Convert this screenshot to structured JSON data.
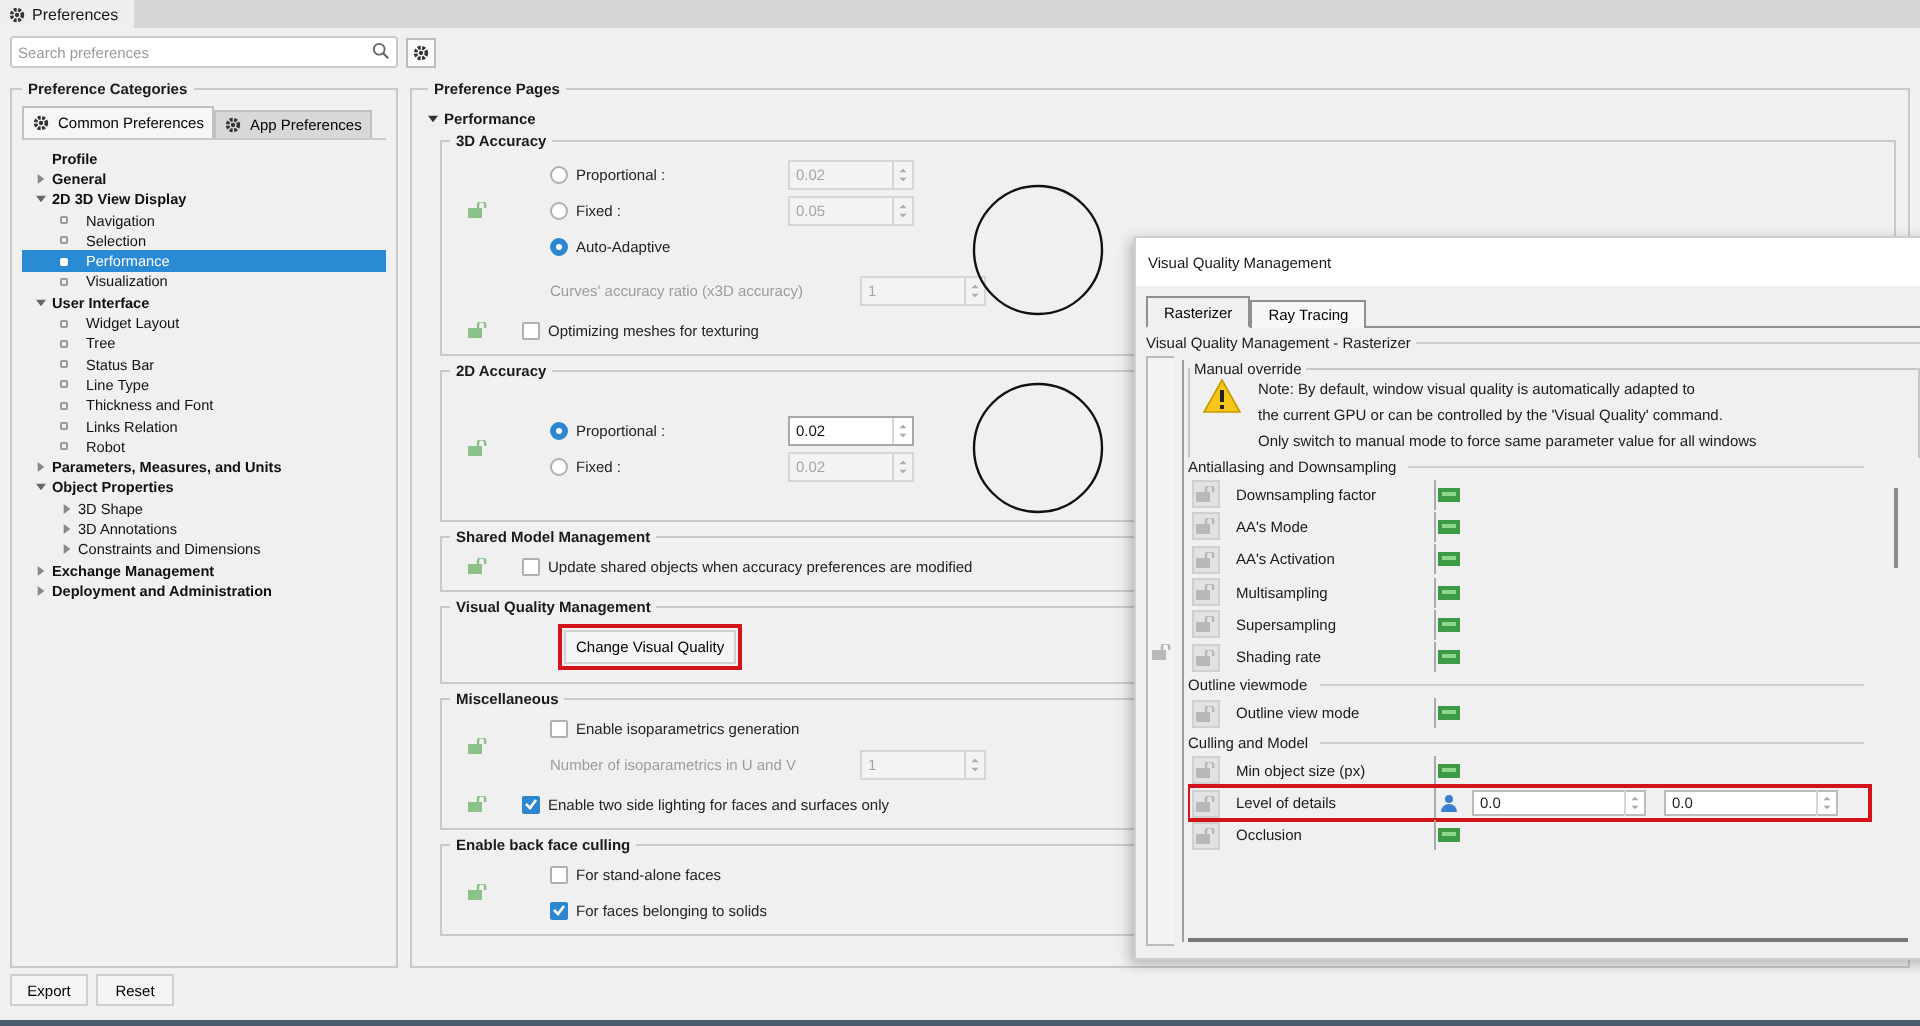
{
  "window": {
    "title": "Preferences"
  },
  "search": {
    "placeholder": "Search preferences"
  },
  "categories": {
    "title": "Preference Categories",
    "tabs": [
      {
        "label": "Common Preferences",
        "selected": true
      },
      {
        "label": "App Preferences",
        "selected": false
      }
    ],
    "tree": [
      {
        "label": "Profile",
        "kind": "plain",
        "selected": false
      },
      {
        "label": "General",
        "kind": "branch",
        "expanded": false,
        "selected": false
      },
      {
        "label": "2D 3D View Display",
        "kind": "branch",
        "expanded": true,
        "selected": false,
        "children": [
          {
            "label": "Navigation",
            "kind": "leaf",
            "selected": false
          },
          {
            "label": "Selection",
            "kind": "leaf",
            "selected": false
          },
          {
            "label": "Performance",
            "kind": "leaf",
            "selected": true
          },
          {
            "label": "Visualization",
            "kind": "leaf",
            "selected": false
          }
        ]
      },
      {
        "label": "User Interface",
        "kind": "branch",
        "expanded": true,
        "selected": false,
        "children": [
          {
            "label": "Widget Layout",
            "kind": "leaf",
            "selected": false
          },
          {
            "label": "Tree",
            "kind": "leaf",
            "selected": false
          },
          {
            "label": "Status Bar",
            "kind": "leaf",
            "selected": false
          },
          {
            "label": "Line Type",
            "kind": "leaf",
            "selected": false
          },
          {
            "label": "Thickness and Font",
            "kind": "leaf",
            "selected": false
          },
          {
            "label": "Links Relation",
            "kind": "leaf",
            "selected": false
          },
          {
            "label": "Robot",
            "kind": "leaf",
            "selected": false
          }
        ]
      },
      {
        "label": "Parameters, Measures, and Units",
        "kind": "branch",
        "expanded": false,
        "selected": false
      },
      {
        "label": "Object Properties",
        "kind": "branch",
        "expanded": true,
        "selected": false,
        "children": [
          {
            "label": "3D Shape",
            "kind": "branch",
            "expanded": false,
            "selected": false
          },
          {
            "label": "3D Annotations",
            "kind": "branch",
            "expanded": false,
            "selected": false
          },
          {
            "label": "Constraints and Dimensions",
            "kind": "branch",
            "expanded": false,
            "selected": false
          }
        ]
      },
      {
        "label": "Exchange Management",
        "kind": "branch",
        "expanded": false,
        "selected": false
      },
      {
        "label": "Deployment and Administration",
        "kind": "branch",
        "expanded": false,
        "selected": false
      }
    ]
  },
  "pages": {
    "title": "Preference Pages",
    "section": {
      "label": "Performance",
      "expanded": true
    },
    "groups": [
      {
        "title": "3D Accuracy",
        "kind": "accuracy",
        "blocks": [
          {
            "lock": true,
            "items": [
              {
                "kind": "radio",
                "label": "Proportional :",
                "selected": false,
                "value": "0.02",
                "disabled": true
              },
              {
                "kind": "radio",
                "label": "Fixed :",
                "selected": false,
                "value": "0.05",
                "disabled": true
              },
              {
                "kind": "radio",
                "label": "Auto-Adaptive",
                "selected": true
              }
            ]
          },
          {
            "lock": false,
            "items": [
              {
                "kind": "spin",
                "label": "Curves' accuracy ratio (x3D accuracy)",
                "value": "1",
                "disabled": true
              }
            ]
          },
          {
            "lock": true,
            "items": [
              {
                "kind": "checkbox",
                "label": "Optimizing meshes for texturing",
                "checked": false
              }
            ]
          }
        ]
      },
      {
        "title": "2D Accuracy",
        "kind": "accuracy",
        "blocks": [
          {
            "lock": true,
            "items": [
              {
                "kind": "radio",
                "label": "Proportional :",
                "selected": true,
                "value": "0.02",
                "disabled": false
              },
              {
                "kind": "radio",
                "label": "Fixed :",
                "selected": false,
                "value": "0.02",
                "disabled": true
              }
            ]
          }
        ]
      },
      {
        "title": "Shared Model Management",
        "kind": "plain",
        "blocks": [
          {
            "lock": true,
            "items": [
              {
                "kind": "checkbox",
                "label": "Update shared objects when accuracy preferences are modified",
                "checked": false
              }
            ]
          }
        ]
      },
      {
        "title": "Visual Quality Management",
        "kind": "plain",
        "blocks": [
          {
            "lock": false,
            "items": [
              {
                "kind": "button",
                "label": "Change Visual Quality",
                "highlighted": true
              }
            ]
          }
        ]
      },
      {
        "title": "Miscellaneous",
        "kind": "plain",
        "blocks": [
          {
            "lock": true,
            "items": [
              {
                "kind": "checkbox",
                "label": "Enable isoparametrics generation",
                "checked": false
              },
              {
                "kind": "spin",
                "label": "Number of isoparametrics in U and V",
                "value": "1",
                "disabled": true
              }
            ]
          },
          {
            "lock": true,
            "items": [
              {
                "kind": "checkbox",
                "label": "Enable two side lighting for faces and surfaces only",
                "checked": true
              }
            ]
          }
        ]
      },
      {
        "title": "Enable back face culling",
        "kind": "plain",
        "blocks": [
          {
            "lock": true,
            "items": [
              {
                "kind": "checkbox",
                "label": "For stand-alone faces",
                "checked": false
              },
              {
                "kind": "checkbox",
                "label": "For faces belonging to solids",
                "checked": true
              }
            ]
          }
        ]
      }
    ]
  },
  "buttons": [
    "Export",
    "Reset"
  ],
  "dialog": {
    "title": "Visual Quality Management",
    "tabs": [
      {
        "label": "Rasterizer",
        "selected": true
      },
      {
        "label": "Ray Tracing",
        "selected": false
      }
    ],
    "group": "Visual Quality Management - Rasterizer",
    "override": {
      "title": "Manual override",
      "note": [
        "Note: By default, window visual quality is automatically adapted to",
        "the current GPU or can be controlled by the 'Visual Quality' command.",
        "Only switch to manual mode to force same parameter value for all windows"
      ]
    },
    "sections": [
      {
        "title": "Antiallasing and Downsampling",
        "rows": [
          {
            "label": "Downsampling factor",
            "kind": "toggle"
          },
          {
            "label": "AA's Mode",
            "kind": "toggle"
          },
          {
            "label": "AA's Activation",
            "kind": "toggle"
          },
          {
            "label": "Multisampling",
            "kind": "toggle"
          },
          {
            "label": "Supersampling",
            "kind": "toggle"
          },
          {
            "label": "Shading rate",
            "kind": "toggle"
          }
        ]
      },
      {
        "title": "Outline viewmode",
        "rows": [
          {
            "label": "Outline view mode",
            "kind": "toggle"
          }
        ]
      },
      {
        "title": "Culling and Model",
        "rows": [
          {
            "label": "Min object size (px)",
            "kind": "toggle"
          },
          {
            "label": "Level of details",
            "kind": "values",
            "values": [
              "0.0",
              "0.0"
            ],
            "highlighted": true
          },
          {
            "label": "Occlusion",
            "kind": "toggle"
          }
        ]
      }
    ]
  }
}
